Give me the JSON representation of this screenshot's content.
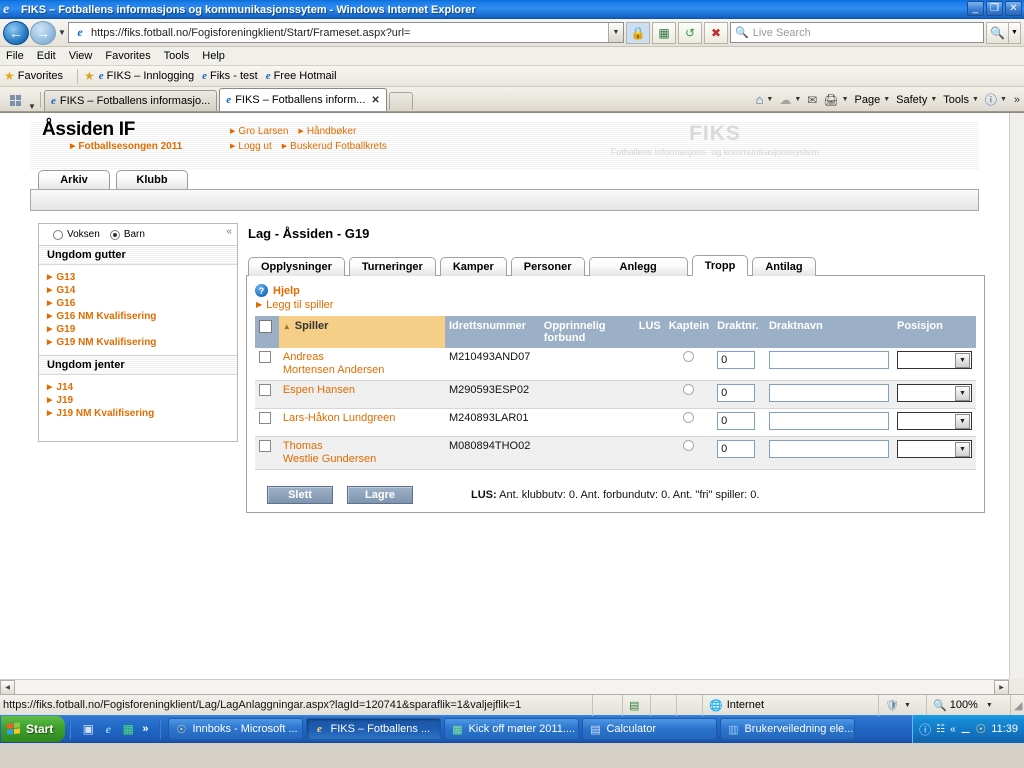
{
  "window": {
    "title": "FIKS – Fotballens informasjons og kommunikasjonssytem - Windows Internet Explorer",
    "minimize": "_",
    "restore": "❐",
    "close": "✕"
  },
  "address_bar": {
    "url": "https://fiks.fotball.no/Fogisforeningklient/Start/Frameset.aspx?url=",
    "search_placeholder": "Live Search",
    "back_icon": "back-arrow-icon",
    "forward_icon": "forward-arrow-icon",
    "lock_icon": "lock-icon",
    "compat_icon": "compatibility-view-icon",
    "refresh_icon": "refresh-icon",
    "stop_icon": "stop-icon",
    "search_icon": "magnifier-icon"
  },
  "menu": {
    "items": [
      "File",
      "Edit",
      "View",
      "Favorites",
      "Tools",
      "Help"
    ]
  },
  "favorites_bar": {
    "label": "Favorites",
    "items": [
      "FIKS – Innlogging",
      "Fiks - test",
      "Free Hotmail"
    ]
  },
  "tab_bar": {
    "tabs": [
      {
        "label": "FIKS – Fotballens informasjo...",
        "active": false
      },
      {
        "label": "FIKS – Fotballens inform...",
        "active": true
      }
    ],
    "close_glyph": "✕",
    "commands": [
      "Page",
      "Safety",
      "Tools"
    ],
    "overflow": "»"
  },
  "site_header": {
    "club": "Åssiden IF",
    "season": "Fotballsesongen 2011",
    "links_row1": [
      "Gro Larsen",
      "Håndbøker"
    ],
    "links_row2": [
      "Logg ut",
      "Buskerud Fotballkrets"
    ],
    "watermark_title": "FIKS",
    "watermark_sub": "Fotballens informasjons- og kommunikasjonssystem",
    "main_tabs": [
      "Arkiv",
      "Klubb"
    ]
  },
  "sidebar": {
    "radios": [
      {
        "label": "Voksen",
        "selected": false
      },
      {
        "label": "Barn",
        "selected": true
      }
    ],
    "collapse_icon": "collapse-chevron-icon",
    "groups": [
      {
        "title": "Ungdom gutter",
        "items": [
          "G13",
          "G14",
          "G16",
          "G16 NM Kvalifisering",
          "G19",
          "G19 NM Kvalifisering"
        ]
      },
      {
        "title": "Ungdom jenter",
        "items": [
          "J14",
          "J19",
          "J19 NM Kvalifisering"
        ]
      }
    ]
  },
  "main": {
    "page_title": "Lag - Åssiden - G19",
    "tabs": [
      {
        "label": "Opplysninger",
        "active": false
      },
      {
        "label": "Turneringer",
        "active": false
      },
      {
        "label": "Kamper",
        "active": false
      },
      {
        "label": "Personer",
        "active": false
      },
      {
        "label": "Anlegg",
        "active": false
      },
      {
        "label": "Tropp",
        "active": true
      },
      {
        "label": "Antilag",
        "active": false
      }
    ],
    "help_label": "Hjelp",
    "help_icon": "question-mark-icon",
    "add_player_label": "Legg til spiller",
    "table": {
      "columns": [
        "",
        "Spiller",
        "Idrettsnummer",
        "Opprinnelig forbund",
        "LUS",
        "Kaptein",
        "Draktnr.",
        "Draktnavn",
        "Posisjon"
      ],
      "sorted_column": "Spiller",
      "sort_icon": "sort-ascending-icon",
      "rows": [
        {
          "name_line1": "Andreas",
          "name_line2": "Mortensen Andersen",
          "idrettsnummer": "M210493AND07",
          "opprinnelig_forbund": "",
          "lus": "",
          "kaptein": false,
          "draktnr": "0",
          "draktnavn": "",
          "posisjon": ""
        },
        {
          "name_line1": "Espen Hansen",
          "name_line2": "",
          "idrettsnummer": "M290593ESP02",
          "opprinnelig_forbund": "",
          "lus": "",
          "kaptein": false,
          "draktnr": "0",
          "draktnavn": "",
          "posisjon": ""
        },
        {
          "name_line1": "Lars-Håkon Lundgreen",
          "name_line2": "",
          "idrettsnummer": "M240893LAR01",
          "opprinnelig_forbund": "",
          "lus": "",
          "kaptein": false,
          "draktnr": "0",
          "draktnavn": "",
          "posisjon": ""
        },
        {
          "name_line1": "Thomas",
          "name_line2": "Westlie Gundersen",
          "idrettsnummer": "M080894THO02",
          "opprinnelig_forbund": "",
          "lus": "",
          "kaptein": false,
          "draktnr": "0",
          "draktnavn": "",
          "posisjon": ""
        }
      ]
    },
    "buttons": {
      "delete": "Slett",
      "save": "Lagre"
    },
    "lus_prefix": "LUS:",
    "lus_text": "Ant. klubbutv: 0. Ant. forbundutv: 0. Ant. \"fri\" spiller: 0."
  },
  "status_bar": {
    "url": "https://fiks.fotball.no/Fogisforeningklient/Lag/LagAnlaggningar.aspx?lagId=120741&sparaflik=1&valjejflik=1",
    "zone": "Internet",
    "zoom": "100%",
    "protected_icon": "shield-icon",
    "globe_icon": "globe-icon"
  },
  "taskbar": {
    "start": "Start",
    "quick_launch": [
      "show-desktop-icon",
      "internet-explorer-icon",
      "excel-icon"
    ],
    "overflow": "»",
    "tasks": [
      {
        "label": "Innboks - Microsoft ...",
        "icon": "outlook-icon",
        "active": false
      },
      {
        "label": "FIKS – Fotballens ...",
        "icon": "internet-explorer-icon",
        "active": true
      },
      {
        "label": "Kick off møter 2011....",
        "icon": "excel-icon",
        "active": false
      },
      {
        "label": "Calculator",
        "icon": "calculator-icon",
        "active": false
      },
      {
        "label": "Brukerveiledning ele...",
        "icon": "word-icon",
        "active": false
      }
    ],
    "tray": {
      "expand": "«",
      "clock": "11:39",
      "icons": [
        "help-icon",
        "network-icon",
        "usb-icon",
        "outlook-icon"
      ]
    }
  },
  "colors": {
    "accent_orange": "#e06c00",
    "header_blue": "#9bb0c6",
    "sort_highlight": "#f5ce87",
    "button_blue": "#8e a5 bd"
  }
}
